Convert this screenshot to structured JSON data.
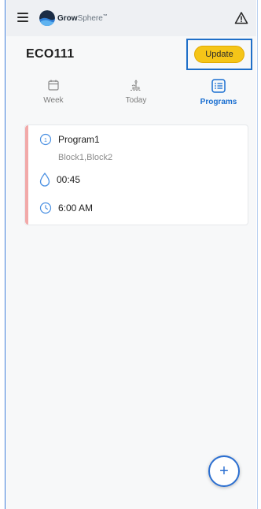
{
  "app": {
    "logo_main": "Grow",
    "logo_secondary": "Sphere",
    "logo_tm": "™"
  },
  "header": {
    "device_title": "ECO111",
    "update_label": "Update"
  },
  "tabs": [
    {
      "label": "Week"
    },
    {
      "label": "Today"
    },
    {
      "label": "Programs"
    }
  ],
  "program_card": {
    "name": "Program1",
    "blocks": "Block1,Block2",
    "duration": "00:45",
    "start_time": "6:00 AM"
  },
  "fab": {
    "label": "+"
  },
  "colors": {
    "accent": "#1a6fd1",
    "update_button": "#f5c518",
    "card_stripe": "#f2a9a9"
  }
}
